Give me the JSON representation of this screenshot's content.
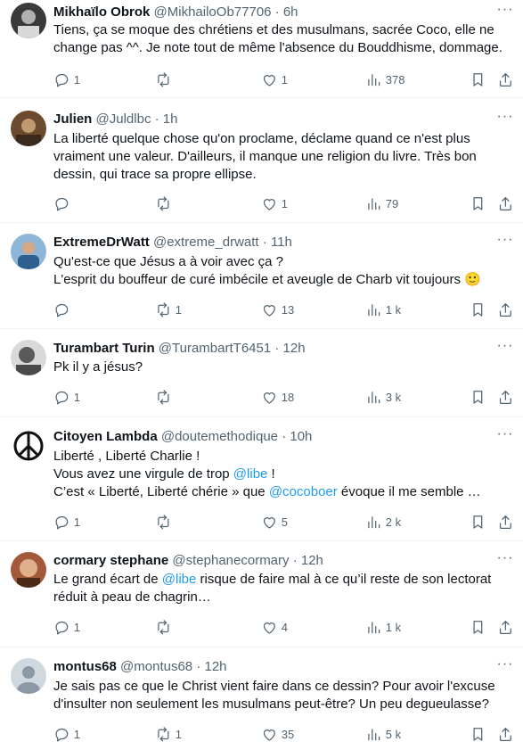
{
  "icons": {
    "reply": "reply-icon",
    "retweet": "retweet-icon",
    "like": "heart-icon",
    "views": "views-icon",
    "bookmark": "bookmark-icon",
    "share": "share-icon",
    "more": "more-icon"
  },
  "colors": {
    "link": "#1d9bf0",
    "secondary": "#536471",
    "text": "#0f1419",
    "divider": "#eff3f4"
  },
  "tweets": [
    {
      "name": "Mikhaïlo Obrok",
      "handle": "@MikhailoOb77706",
      "dot": "·",
      "time": "6h",
      "lines": [
        "Tiens, ça se moque des chrétiens et des musulmans, sacrée Coco, elle ne",
        "change pas ^^. Je note tout de même l'absence du Bouddhisme, dommage."
      ],
      "replies": "1",
      "retweets": "",
      "likes": "1",
      "views": "378"
    },
    {
      "name": "Julien",
      "handle": "@Juldlbc",
      "dot": "·",
      "time": "1h",
      "lines": [
        "La liberté quelque chose qu'on proclame, déclame quand ce n'est plus",
        "vraiment une valeur. D'ailleurs, il manque une religion du livre. Très bon",
        "dessin, qui trace sa propre ellipse."
      ],
      "replies": "",
      "retweets": "",
      "likes": "1",
      "views": "79"
    },
    {
      "name": "ExtremeDrWatt",
      "handle": "@extreme_drwatt",
      "dot": "·",
      "time": "11h",
      "lines": [
        "Qu'est-ce que Jésus a à voir avec ça ?",
        "L'esprit du bouffeur de curé imbécile et aveugle de Charb vit toujours 🙂"
      ],
      "replies": "",
      "retweets": "1",
      "likes": "13",
      "views": "1 k"
    },
    {
      "name": "Turambart Turin",
      "handle": "@TurambartT6451",
      "dot": "·",
      "time": "12h",
      "lines": [
        "Pk il y a jésus?"
      ],
      "replies": "1",
      "retweets": "",
      "likes": "18",
      "views": "3 k"
    },
    {
      "name": "Citoyen Lambda",
      "handle": "@doutemethodique",
      "dot": "·",
      "time": "10h",
      "lines": [
        "Liberté , Liberté Charlie !",
        "Vous avez une virgule de trop ",
        "C’est « Liberté, Liberté chérie » que "
      ],
      "mention1": "@libe",
      "after1": " !",
      "mention2": "@cocoboer",
      "after2": " évoque il me semble …",
      "replies": "1",
      "retweets": "",
      "likes": "5",
      "views": "2 k"
    },
    {
      "name": "cormary stephane",
      "handle": "@stephanecormary",
      "dot": "·",
      "time": "12h",
      "lines": [
        "Le grand écart de ",
        "réduit à peau de chagrin…"
      ],
      "mention1": "@libe",
      "after1": " risque de faire mal à ce qu’il reste de son lectorat",
      "replies": "1",
      "retweets": "",
      "likes": "4",
      "views": "1 k"
    },
    {
      "name": "montus68",
      "handle": "@montus68",
      "dot": "·",
      "time": "12h",
      "lines": [
        "Je sais pas ce que le Christ vient faire dans ce dessin? Pour avoir l'excuse",
        "d'insulter non seulement les musulmans peut-être? Un peu degueulasse?"
      ],
      "replies": "1",
      "retweets": "1",
      "likes": "35",
      "views": "5 k"
    }
  ]
}
